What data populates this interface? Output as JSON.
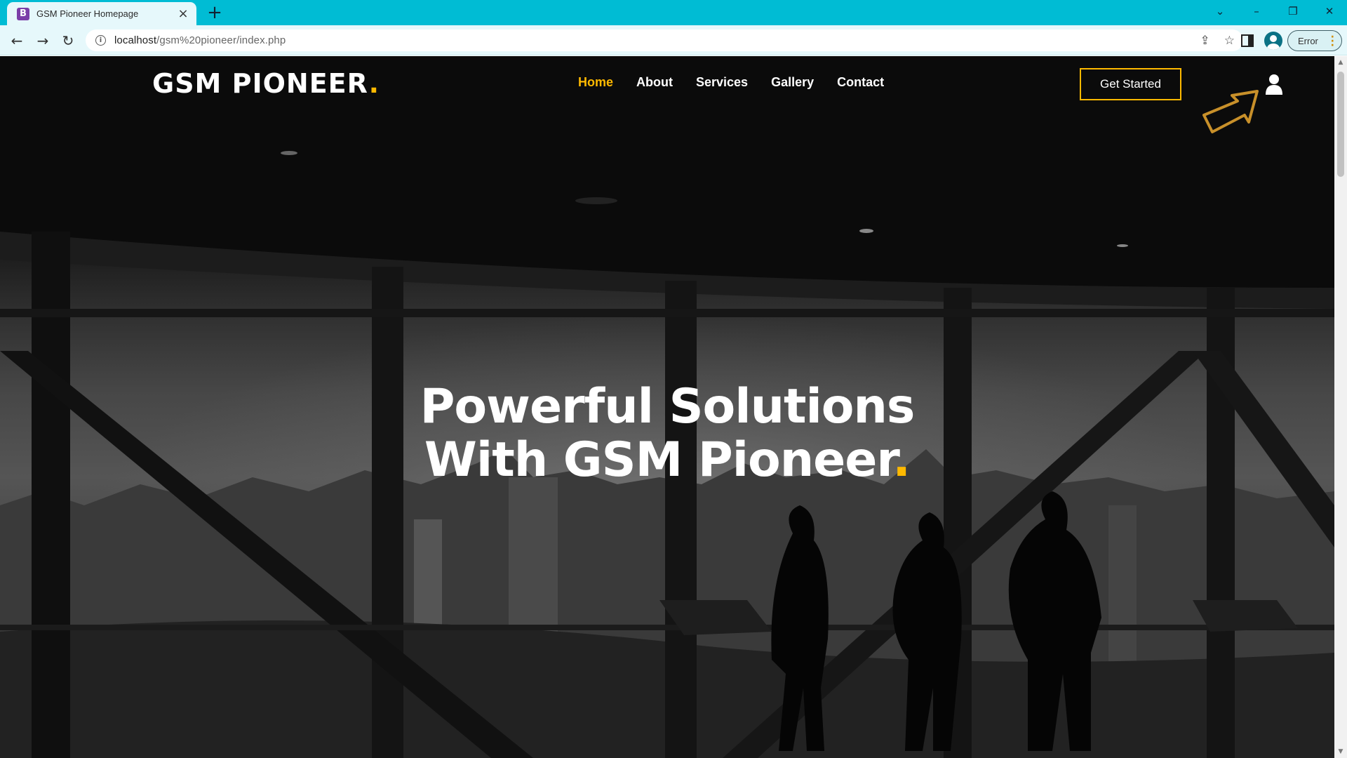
{
  "browser": {
    "tab_title": "GSM Pioneer Homepage",
    "favicon_letter": "B",
    "url_host": "localhost",
    "url_path": "/gsm%20pioneer/index.php",
    "profile_status": "Error"
  },
  "site": {
    "logo_text": "GSM PIONEER",
    "logo_dot": ".",
    "nav": [
      {
        "label": "Home",
        "active": true
      },
      {
        "label": "About"
      },
      {
        "label": "Services"
      },
      {
        "label": "Gallery"
      },
      {
        "label": "Contact"
      }
    ],
    "cta_label": "Get Started",
    "user_icon": "user-icon",
    "accent_color": "#feb900"
  },
  "hero": {
    "title_line1": "Powerful Solutions",
    "title_line2": "With GSM Pioneer",
    "title_dot": "."
  }
}
